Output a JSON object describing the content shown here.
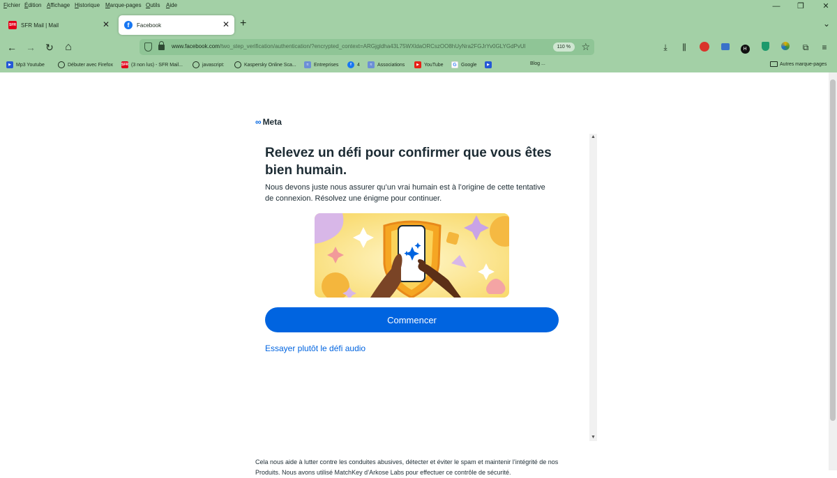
{
  "menubar": [
    "Fichier",
    "Édition",
    "Affichage",
    "Historique",
    "Marque-pages",
    "Outils",
    "Aide"
  ],
  "window_controls": {
    "minimize": "—",
    "restore": "❐",
    "close": "✕"
  },
  "tabs": [
    {
      "title": "SFR Mail | Mail",
      "favicon": "SFR",
      "active": false
    },
    {
      "title": "Facebook",
      "favicon": "f",
      "active": true
    }
  ],
  "new_tab": "+",
  "tab_list": "⌄",
  "nav": {
    "back": "←",
    "forward": "→",
    "reload": "↻",
    "home": "⌂"
  },
  "url": {
    "host": "www.facebook.com",
    "path": "/two_step_verification/authentication/?encrypted_context=ARGjgldha43L75WXldaORCszOO8hUyNra2FGJrYv0GLYGdPvUl",
    "zoom": "110 %",
    "bookmark_star": "☆"
  },
  "toolbar_icons": [
    "download-icon",
    "library-icon",
    "extension-badge-icon",
    "extension-icon",
    "extension-h-icon",
    "shield-extension-icon",
    "extension-color-icon",
    "puzzle-icon",
    "menu-icon"
  ],
  "bookmarks": [
    {
      "label": "Mp3 Youtube",
      "icon": "youtube-icon"
    },
    {
      "label": "Débuter avec Firefox",
      "icon": "globe-icon"
    },
    {
      "label": "(3 non lus) - SFR Mail...",
      "icon": "sfr-icon"
    },
    {
      "label": "javascript:",
      "icon": "globe-icon"
    },
    {
      "label": "Kaspersky Online Sca...",
      "icon": "globe-icon"
    },
    {
      "label": "Entreprises",
      "icon": "associations-icon"
    },
    {
      "label": "4",
      "icon": "facebook-icon"
    },
    {
      "label": "Associations",
      "icon": "associations-icon"
    },
    {
      "label": "YouTube",
      "icon": "youtube-icon"
    },
    {
      "label": "Google",
      "icon": "google-icon"
    },
    {
      "label": "",
      "icon": "youtube-blue-icon"
    },
    {
      "label": "Blog ...",
      "icon": ""
    }
  ],
  "other_bookmarks": "Autres marque-pages",
  "page": {
    "logo": "Meta",
    "title": "Relevez un défi pour confirmer que vous êtes bien humain.",
    "subtitle": "Nous devons juste nous assurer qu’un vrai humain est à l’origine de cette tentative de connexion. Résolvez une énigme pour continuer.",
    "start_button": "Commencer",
    "audio_link": "Essayer plutôt le défi audio",
    "footer": "Cela nous aide à lutter contre les conduites abusives, détecter et éviter le spam et maintenir l’intégrité de nos Produits. Nous avons utilisé MatchKey d’Arkose Labs pour effectuer ce contrôle de sécurité."
  },
  "colors": {
    "chrome": "#a3d0a6",
    "accent": "#0064e0",
    "text": "#1c2b33"
  }
}
